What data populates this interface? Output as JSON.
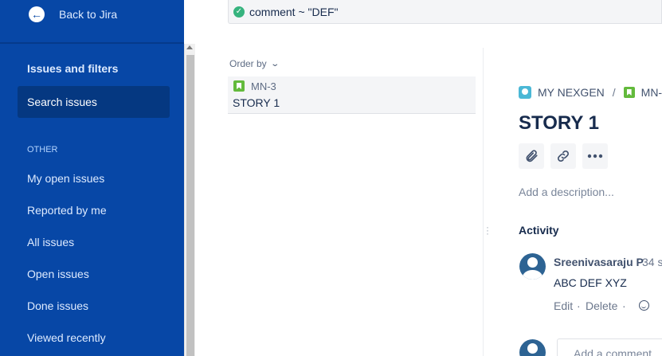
{
  "sidebar": {
    "back_label": "Back to Jira",
    "title": "Issues and filters",
    "active_item": "Search issues",
    "section_label": "OTHER",
    "items": [
      {
        "label": "My open issues"
      },
      {
        "label": "Reported by me"
      },
      {
        "label": "All issues"
      },
      {
        "label": "Open issues"
      },
      {
        "label": "Done issues"
      },
      {
        "label": "Viewed recently"
      }
    ]
  },
  "query": {
    "text": "comment ~ \"DEF\"",
    "status": "valid"
  },
  "list": {
    "order_by_label": "Order by",
    "issues": [
      {
        "key": "MN-3",
        "summary": "STORY 1",
        "type": "story"
      }
    ]
  },
  "detail": {
    "breadcrumb": {
      "project": "MY NEXGEN",
      "separator": "/",
      "issue_key": "MN-"
    },
    "title": "STORY 1",
    "toolbar_icons": [
      "paperclip-icon",
      "link-icon",
      "more-icon"
    ],
    "description_placeholder": "Add a description...",
    "activity_label": "Activity",
    "comment": {
      "author": "Sreenivasaraju P",
      "time": "34 s",
      "body": "ABC DEF XYZ",
      "edit_label": "Edit",
      "separator": "·",
      "delete_label": "Delete"
    },
    "add_comment_placeholder": "Add a comment..."
  },
  "colors": {
    "sidebar": "#0747a6",
    "sidebar_active": "#053881",
    "story": "#63ba3c",
    "success": "#36b37e",
    "avatar": "#2d6393"
  }
}
